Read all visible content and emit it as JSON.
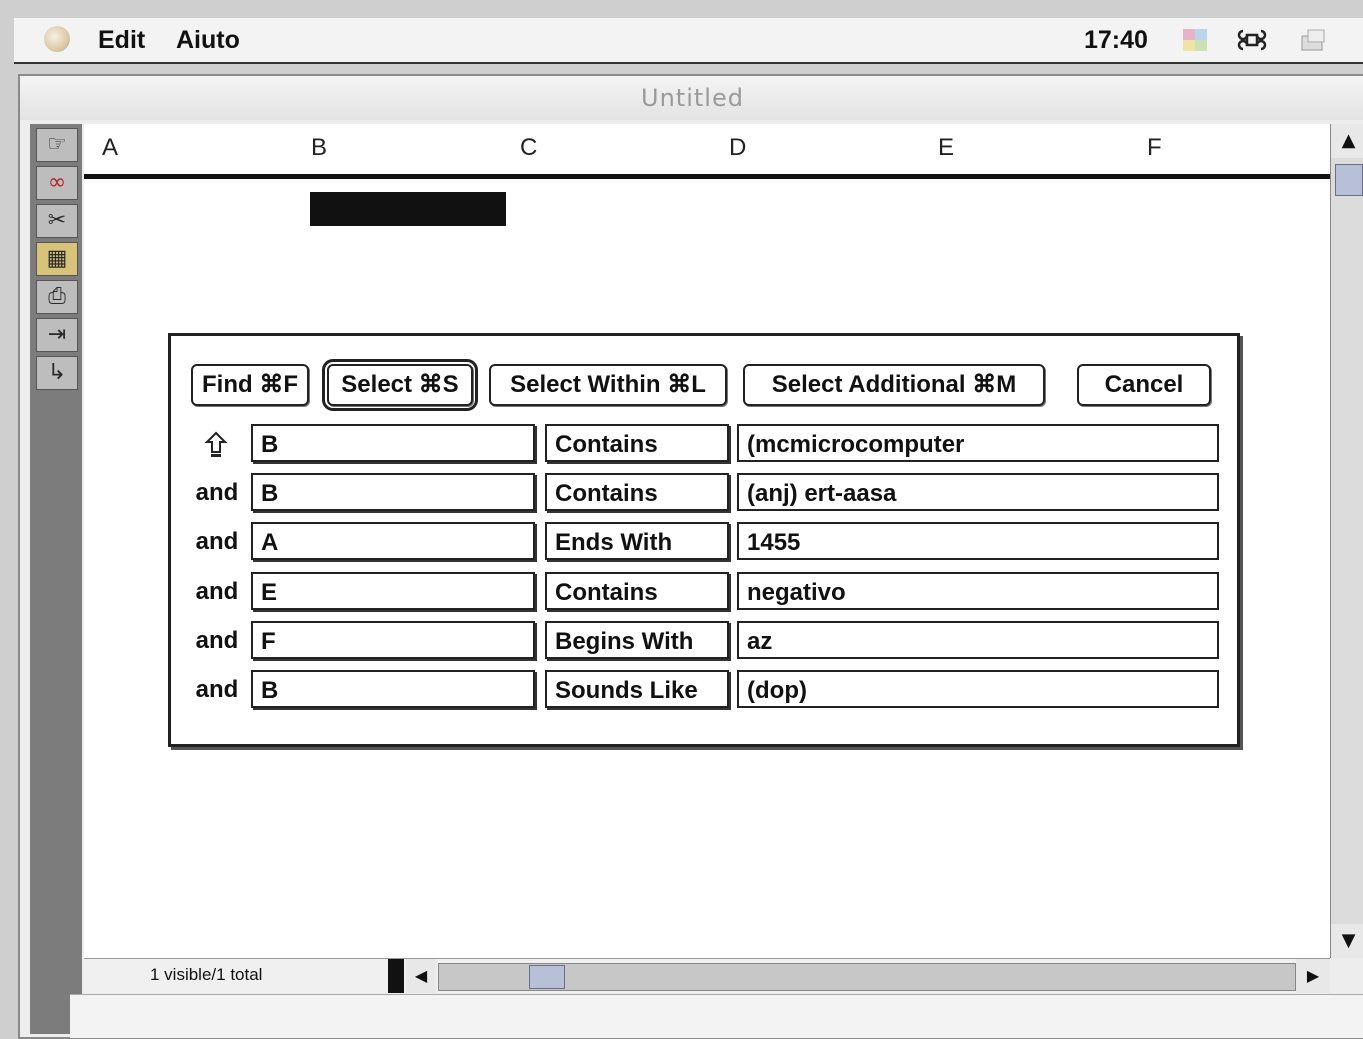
{
  "menubar": {
    "items": [
      "Edit",
      "Aiuto"
    ],
    "clock": "17:40"
  },
  "window": {
    "title": "Untitled"
  },
  "sheet": {
    "columns": [
      "A",
      "B",
      "C",
      "D",
      "E",
      "F"
    ]
  },
  "status": {
    "text": "1 visible/1 total"
  },
  "dialog": {
    "buttons": {
      "find": "Find ⌘F",
      "select": "Select ⌘S",
      "select_within": "Select Within ⌘L",
      "select_additional": "Select Additional ⌘M",
      "cancel": "Cancel"
    },
    "rows": [
      {
        "connector": "",
        "column": "B",
        "operator": "Contains",
        "value": "(mcmicrocomputer"
      },
      {
        "connector": "and",
        "column": "B",
        "operator": "Contains",
        "value": "(anj) ert-aasa"
      },
      {
        "connector": "and",
        "column": "A",
        "operator": "Ends With",
        "value": "1455"
      },
      {
        "connector": "and",
        "column": "E",
        "operator": "Contains",
        "value": "negativo"
      },
      {
        "connector": "and",
        "column": "F",
        "operator": "Begins With",
        "value": "az"
      },
      {
        "connector": "and",
        "column": "B",
        "operator": "Sounds Like",
        "value": "(dop)"
      }
    ]
  }
}
